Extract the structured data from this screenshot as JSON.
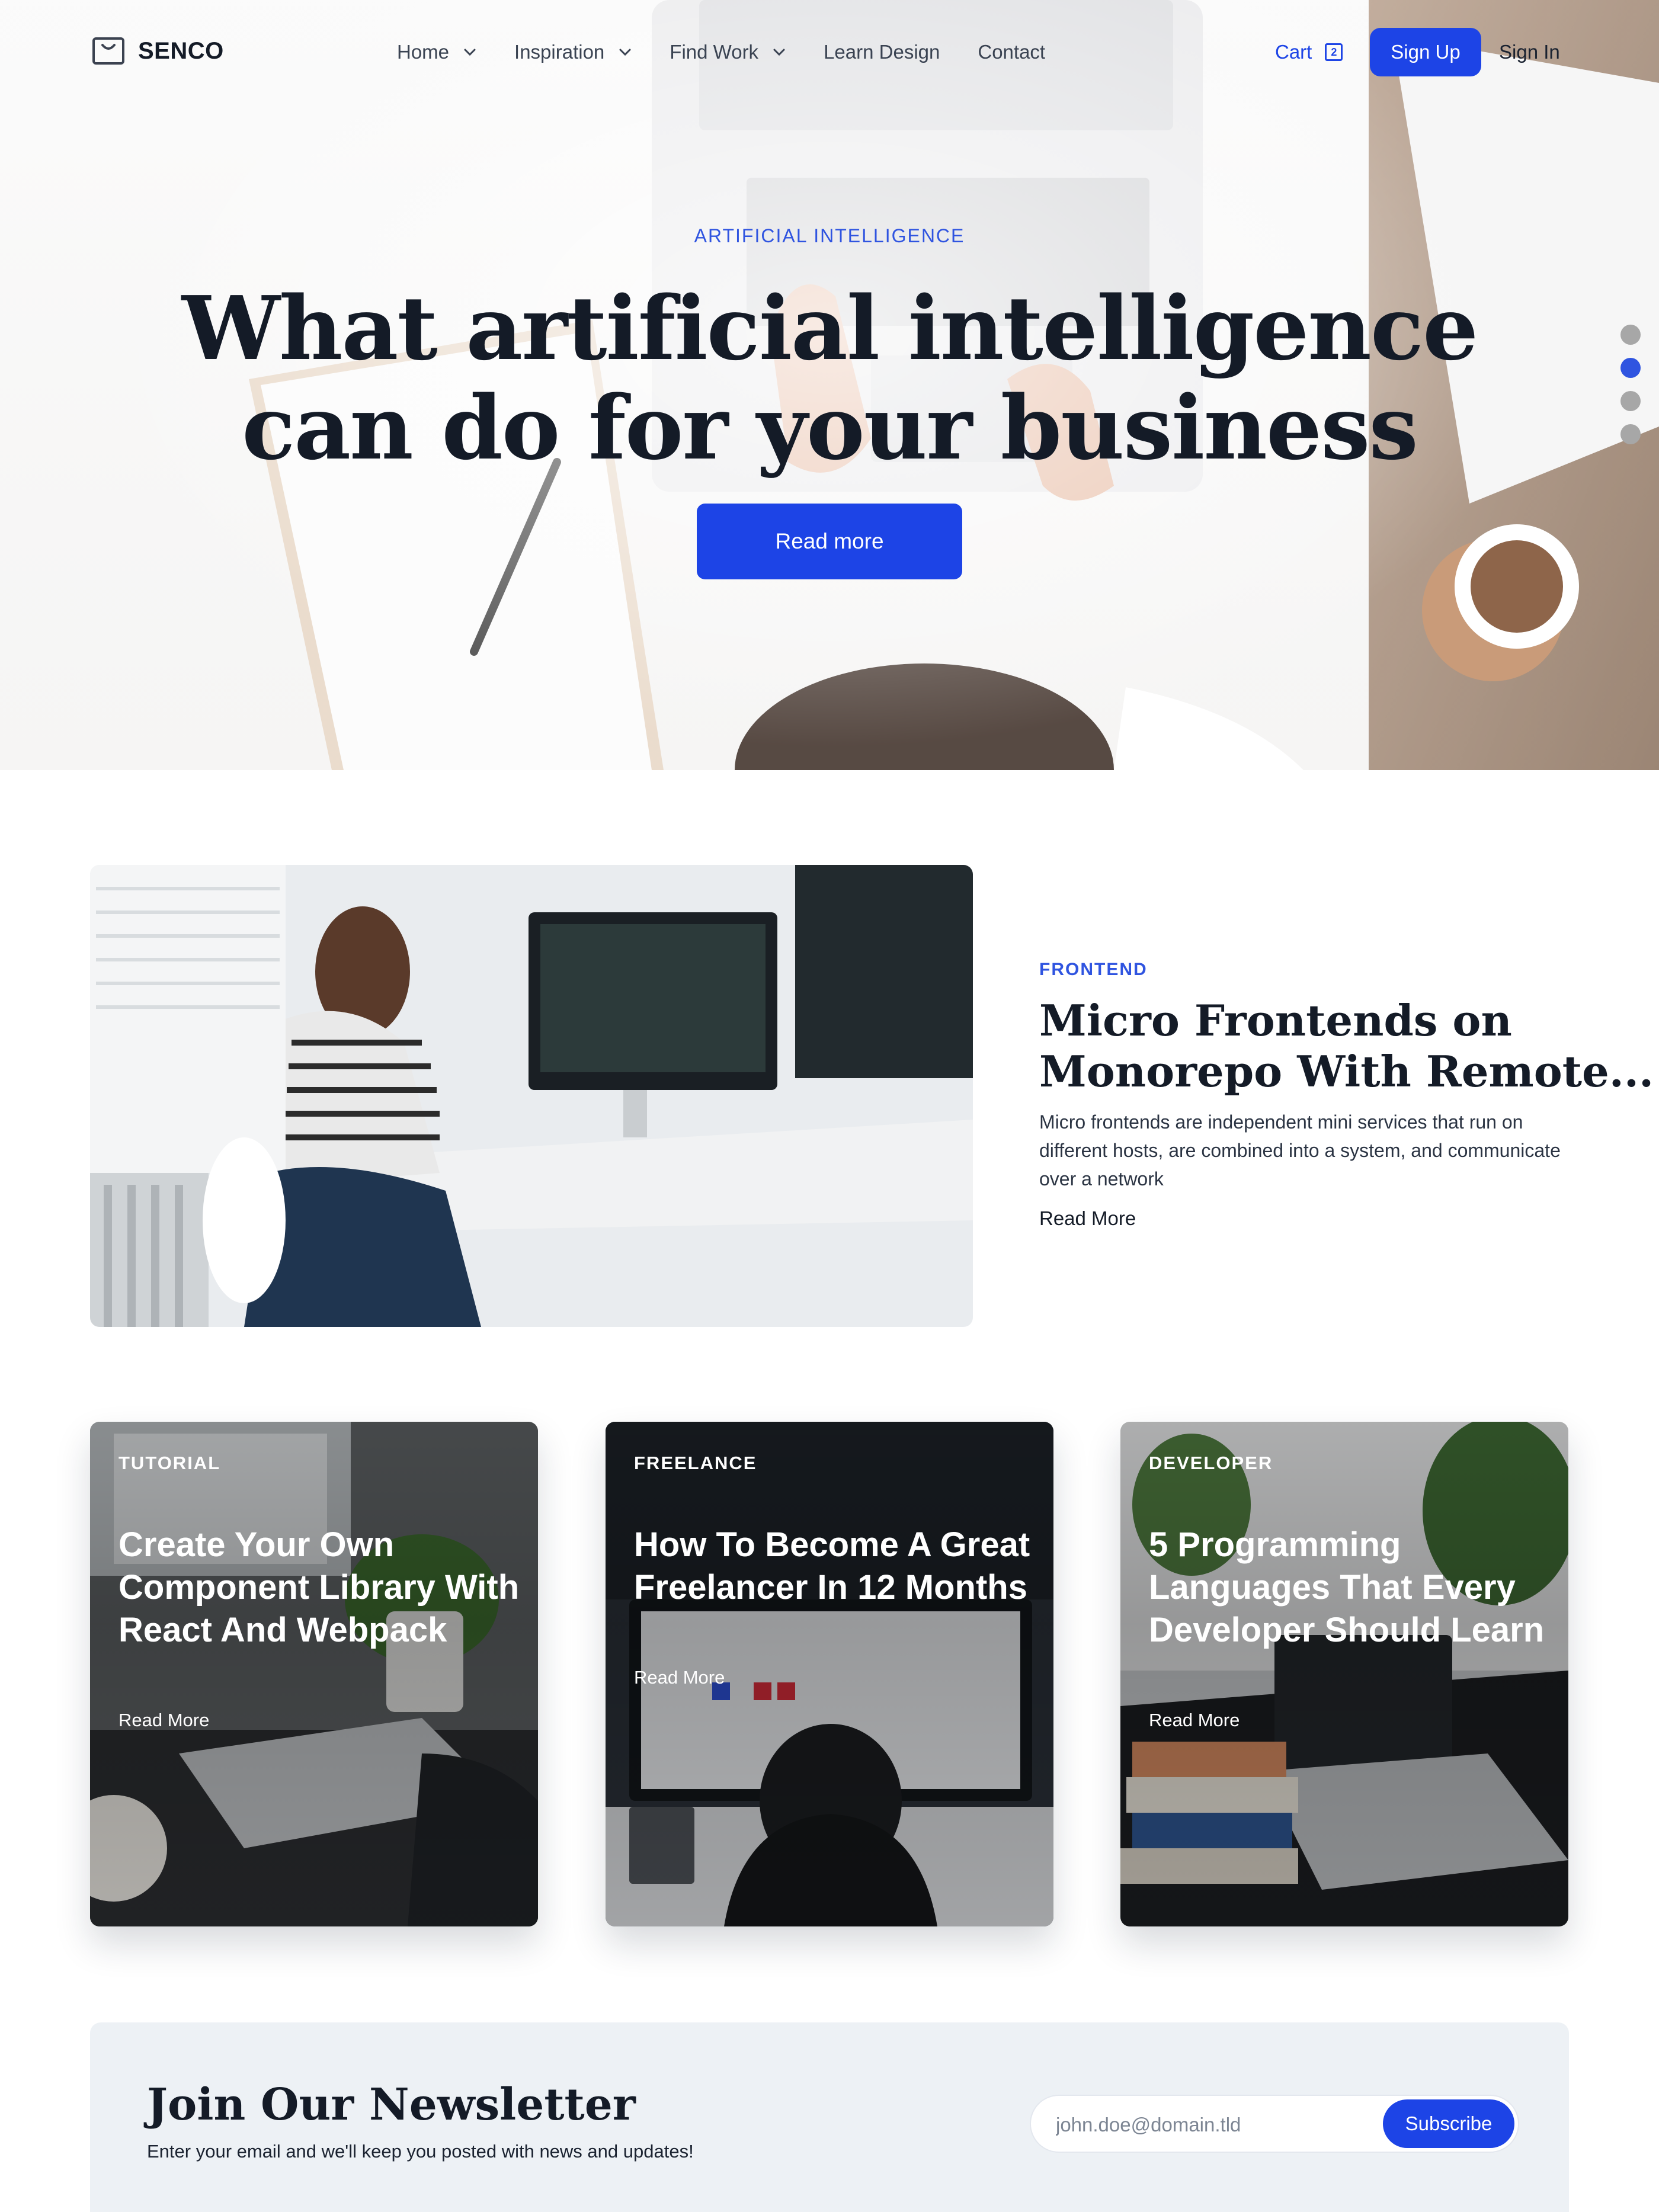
{
  "nav": {
    "brand": "SENCO",
    "logo_icon": "shopping-bag-icon",
    "menu": [
      {
        "label": "Home",
        "has_dropdown": true
      },
      {
        "label": "Inspiration",
        "has_dropdown": true
      },
      {
        "label": "Find Work",
        "has_dropdown": true
      },
      {
        "label": "Learn Design",
        "has_dropdown": false
      },
      {
        "label": "Contact",
        "has_dropdown": false
      }
    ],
    "cart_label": "Cart",
    "cart_count": "2",
    "signup_label": "Sign Up",
    "signin_label": "Sign In"
  },
  "hero": {
    "category": "ARTIFICIAL INTELLIGENCE",
    "title": "What artificial intelligence can do for your business",
    "button_label": "Read more",
    "slides_count": 4,
    "active_slide": 2
  },
  "featured": {
    "category": "FRONTEND",
    "title_line1": "Micro Frontends on",
    "title_line2": "Monorepo With Remote...",
    "description": "Micro frontends are independent mini services that run on different hosts, are combined into a system, and communicate over a network",
    "link_label": "Read More"
  },
  "cards": [
    {
      "category": "TUTORIAL",
      "title": "Create Your Own Component Library With React And Webpack",
      "link_label": "Read More"
    },
    {
      "category": "FREELANCE",
      "title": "How To Become A Great Freelancer In 12 Months",
      "link_label": "Read More"
    },
    {
      "category": "DEVELOPER",
      "title": "5 Programming Languages That Every Developer Should Learn",
      "link_label": "Read More"
    }
  ],
  "newsletter": {
    "title": "Join Our Newsletter",
    "subtitle": "Enter your email and we'll keep you posted with news and updates!",
    "email_placeholder": "john.doe@domain.tld",
    "button_label": "Subscribe"
  },
  "colors": {
    "accent": "#1d44e6",
    "eyebrow": "#2f54e0",
    "heading": "#141b27",
    "newsletter_bg": "#edf1f5"
  }
}
